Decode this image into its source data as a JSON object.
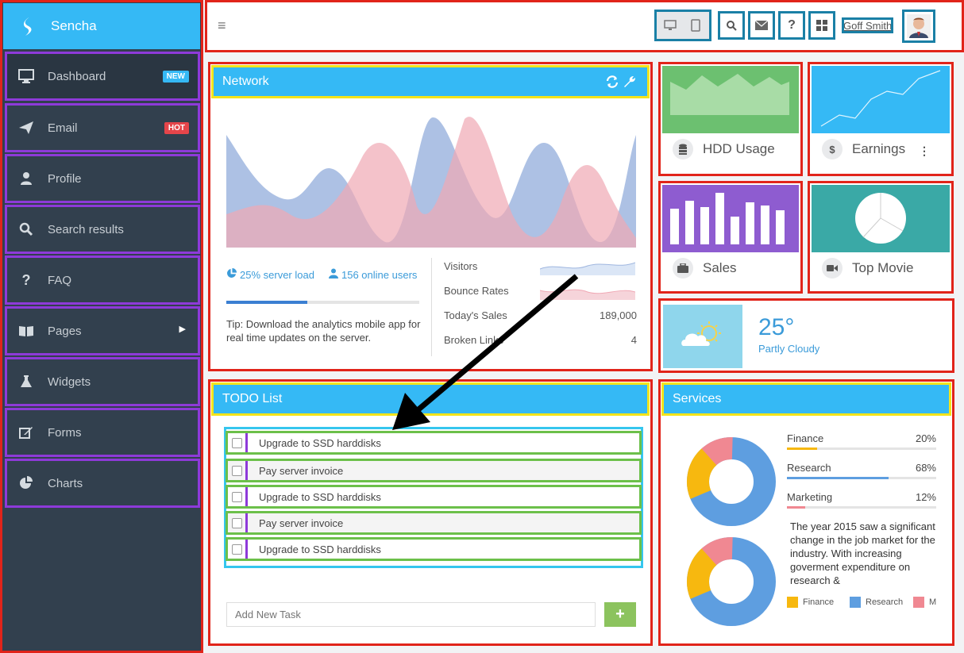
{
  "brand": {
    "name": "Sencha"
  },
  "sidebar": {
    "items": [
      {
        "label": "Dashboard",
        "badge": "NEW",
        "badge_color": "#35b9f5",
        "icon": "monitor-icon"
      },
      {
        "label": "Email",
        "badge": "HOT",
        "badge_color": "#e5454a",
        "icon": "paper-plane-icon"
      },
      {
        "label": "Profile",
        "icon": "user-icon"
      },
      {
        "label": "Search results",
        "icon": "search-icon"
      },
      {
        "label": "FAQ",
        "icon": "question-icon"
      },
      {
        "label": "Pages",
        "icon": "book-icon"
      },
      {
        "label": "Widgets",
        "icon": "flask-icon"
      },
      {
        "label": "Forms",
        "icon": "edit-icon"
      },
      {
        "label": "Charts",
        "icon": "pie-chart-icon"
      }
    ]
  },
  "header": {
    "user_name": "Goff Smith"
  },
  "network": {
    "title": "Network",
    "server_load": "25% server load",
    "online_users": "156 online users",
    "progress": 0.42,
    "tip": "Tip: Download the analytics mobile app for real time updates on the server.",
    "stats": [
      {
        "label": "Visitors"
      },
      {
        "label": "Bounce Rates"
      },
      {
        "label": "Today's Sales",
        "value": "189,000"
      },
      {
        "label": "Broken Links",
        "value": "4"
      }
    ]
  },
  "tiles": {
    "hdd": {
      "label": "HDD Usage",
      "color": "#6cc070"
    },
    "earnings": {
      "label": "Earnings",
      "color": "#35b9f5"
    },
    "sales": {
      "label": "Sales",
      "color": "#8e5cd0"
    },
    "top_movie": {
      "label": "Top Movie",
      "color": "#3aa9a6"
    }
  },
  "weather": {
    "temp": "25°",
    "condition": "Partly Cloudy"
  },
  "todo": {
    "title": "TODO List",
    "items": [
      "Upgrade to SSD harddisks",
      "Pay server invoice",
      "Upgrade to SSD harddisks",
      "Pay server invoice",
      "Upgrade to SSD harddisks"
    ],
    "add_placeholder": "Add New Task"
  },
  "services": {
    "title": "Services",
    "rows": [
      {
        "label": "Finance",
        "pct": "20%",
        "value": 0.2,
        "color": "#f7b80f"
      },
      {
        "label": "Research",
        "pct": "68%",
        "value": 0.68,
        "color": "#5e9ee0"
      },
      {
        "label": "Marketing",
        "pct": "12%",
        "value": 0.12,
        "color": "#f08892"
      }
    ],
    "text": "The year 2015 saw a significant change in the job market for the industry. With increasing goverment expenditure on research &",
    "legend": [
      "Finance",
      "Research",
      "M"
    ]
  }
}
